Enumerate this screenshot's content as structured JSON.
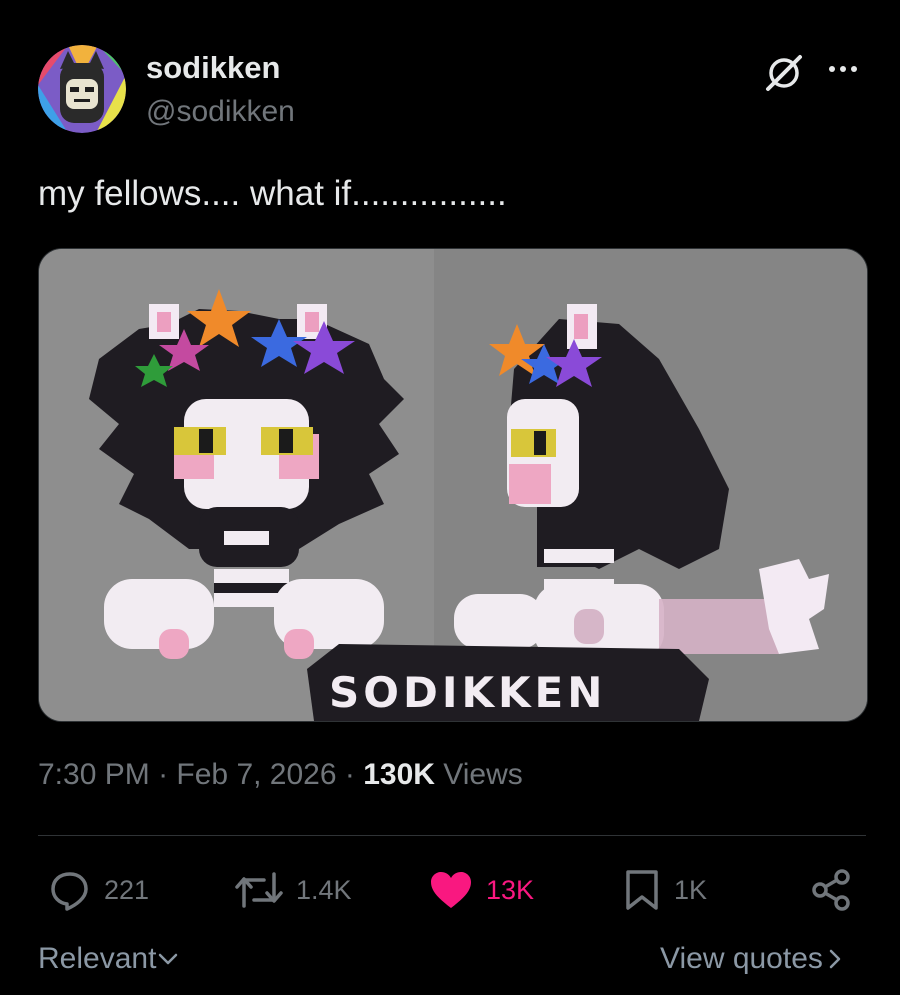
{
  "author": {
    "display_name": "sodikken",
    "handle": "@sodikken",
    "avatar_icon": "avatar-image"
  },
  "header": {
    "grok_icon": "grok-icon",
    "more_icon": "more-icon"
  },
  "tweet": {
    "text": "my fellows.... what if................",
    "media": {
      "watermark": "SODIKKEN"
    },
    "time": "7:30 PM",
    "date": "Feb 7, 2026",
    "views_count": "130K",
    "views_label": "Views",
    "separator": "·"
  },
  "actions": {
    "replies": "221",
    "reposts": "1.4K",
    "likes": "13K",
    "bookmarks": "1K"
  },
  "footer": {
    "sort_label": "Relevant",
    "quotes_label": "View quotes"
  },
  "colors": {
    "background": "#000000",
    "primary_text": "#e7e9ea",
    "secondary_text": "#71767b",
    "like_active": "#f91880"
  }
}
